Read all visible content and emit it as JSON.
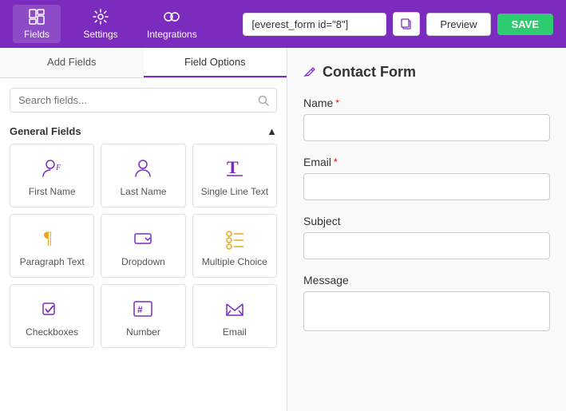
{
  "nav": {
    "items": [
      {
        "id": "fields",
        "label": "Fields",
        "active": true
      },
      {
        "id": "settings",
        "label": "Settings",
        "active": false
      },
      {
        "id": "integrations",
        "label": "Integrations",
        "active": false
      }
    ],
    "shortcode": "[everest_form id=\"8\"]",
    "preview_label": "Preview",
    "save_label": "SAVE"
  },
  "left_panel": {
    "tabs": [
      {
        "id": "add-fields",
        "label": "Add Fields",
        "active": false
      },
      {
        "id": "field-options",
        "label": "Field Options",
        "active": true
      }
    ],
    "search_placeholder": "Search fields...",
    "section_label": "General Fields",
    "fields": [
      {
        "id": "first-name",
        "label": "First Name",
        "icon": "first-name"
      },
      {
        "id": "last-name",
        "label": "Last Name",
        "icon": "last-name"
      },
      {
        "id": "single-line",
        "label": "Single Line Text",
        "icon": "single-line"
      },
      {
        "id": "paragraph",
        "label": "Paragraph Text",
        "icon": "paragraph"
      },
      {
        "id": "dropdown",
        "label": "Dropdown",
        "icon": "dropdown"
      },
      {
        "id": "multiple-choice",
        "label": "Multiple Choice",
        "icon": "multiple-choice"
      },
      {
        "id": "checkboxes",
        "label": "Checkboxes",
        "icon": "checkboxes"
      },
      {
        "id": "number",
        "label": "Number",
        "icon": "number"
      },
      {
        "id": "email",
        "label": "Email",
        "icon": "email"
      }
    ]
  },
  "right_panel": {
    "form_title": "Contact Form",
    "fields": [
      {
        "id": "name",
        "label": "Name",
        "required": true,
        "type": "input"
      },
      {
        "id": "email",
        "label": "Email",
        "required": true,
        "type": "input"
      },
      {
        "id": "subject",
        "label": "Subject",
        "required": false,
        "type": "input"
      },
      {
        "id": "message",
        "label": "Message",
        "required": false,
        "type": "textarea"
      }
    ]
  },
  "colors": {
    "purple": "#7b2cbf",
    "green": "#2ecc71",
    "red": "#e74c3c"
  }
}
